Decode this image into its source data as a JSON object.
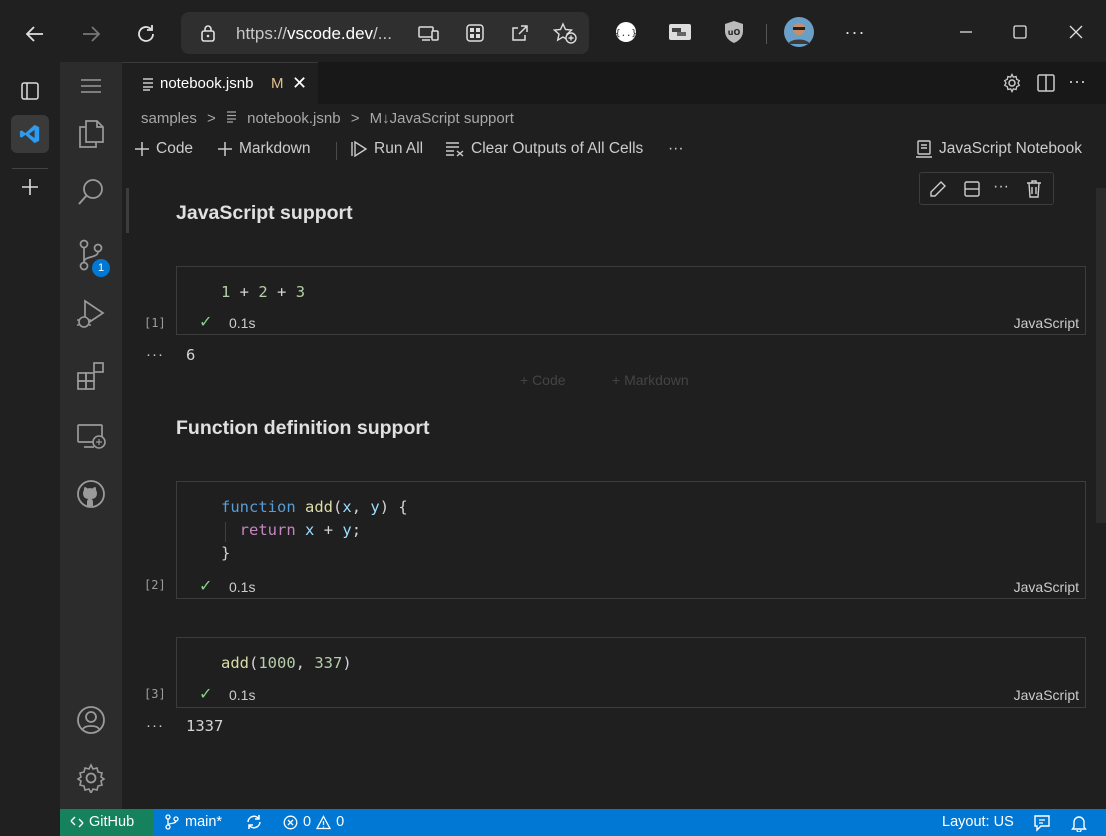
{
  "browser": {
    "url_prefix": "https://",
    "url_host": "vscode.dev",
    "url_rest": "/...",
    "icons": [
      "back-icon",
      "forward-icon",
      "refresh-icon",
      "lock-icon",
      "app-available-icon",
      "grid-icon",
      "share-icon",
      "favorites-icon",
      "json-extension-icon",
      "window-extension-icon",
      "ublock-icon",
      "profile-avatar",
      "more-icon",
      "minimize-icon",
      "maximize-icon",
      "close-icon"
    ]
  },
  "editor": {
    "tab": {
      "name": "notebook.jsnb",
      "modified": "M",
      "close": "✕"
    },
    "breadcrumbs": [
      "samples",
      ">",
      "notebook.jsnb",
      ">",
      "M↓JavaScript support"
    ],
    "toolbar": {
      "code": "Code",
      "markdown": "Markdown",
      "run_all": "Run All",
      "clear_outputs": "Clear Outputs of All Cells",
      "more": "···",
      "kernel": "JavaScript Notebook"
    },
    "cells": {
      "md1": "JavaScript support",
      "c1": {
        "exec": "[1]",
        "time": "0.1s",
        "lang": "JavaScript",
        "output": "6"
      },
      "insert_code": "+ Code",
      "insert_markdown": "+ Markdown",
      "md2": "Function definition support",
      "c2": {
        "exec": "[2]",
        "time": "0.1s",
        "lang": "JavaScript"
      },
      "c3": {
        "exec": "[3]",
        "time": "0.1s",
        "lang": "JavaScript",
        "output": "1337"
      }
    }
  },
  "activity": {
    "scm_badge": "1"
  },
  "status": {
    "remote": "GitHub",
    "branch": "main*",
    "errors": "0",
    "warnings": "0",
    "layout": "Layout: US"
  }
}
